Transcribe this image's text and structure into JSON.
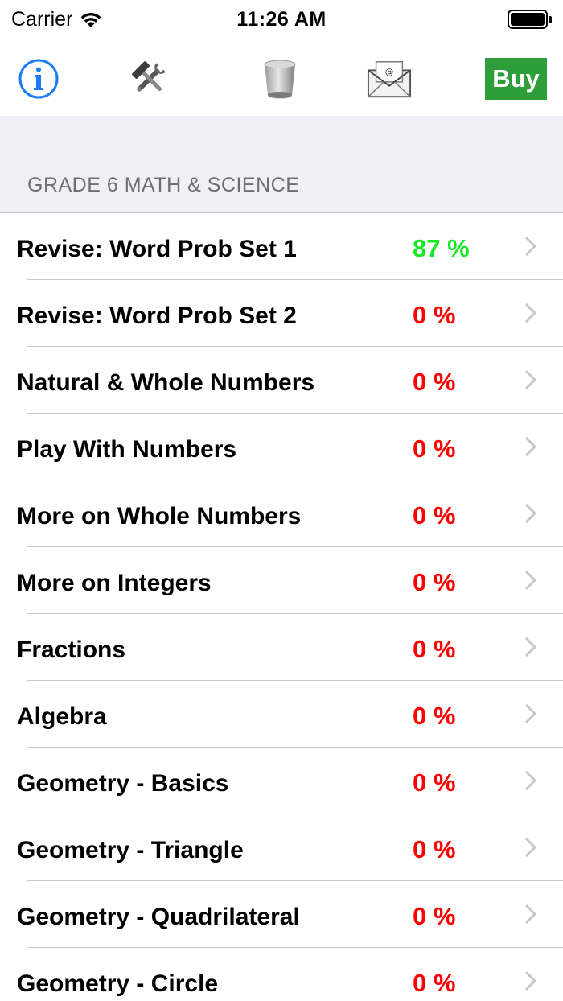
{
  "status_bar": {
    "carrier": "Carrier",
    "time": "11:26 AM"
  },
  "toolbar": {
    "icons": [
      "info-icon",
      "tools-icon",
      "trash-icon",
      "mail-icon"
    ],
    "buy_label": "Buy",
    "buy_color": "#2d9e3a",
    "info_color": "#1a7cf5"
  },
  "section": {
    "title": "GRADE 6 MATH & SCIENCE"
  },
  "colors": {
    "pct_zero": "#ff0000",
    "pct_positive": "#11ea21",
    "chevron": "#c7c7cc"
  },
  "items": [
    {
      "label": "Revise: Word Prob Set 1",
      "percent": "87 %",
      "status": "positive"
    },
    {
      "label": "Revise: Word Prob Set 2",
      "percent": "0 %",
      "status": "zero"
    },
    {
      "label": "Natural & Whole Numbers",
      "percent": "0 %",
      "status": "zero"
    },
    {
      "label": "Play With Numbers",
      "percent": "0 %",
      "status": "zero"
    },
    {
      "label": "More on Whole Numbers",
      "percent": "0 %",
      "status": "zero"
    },
    {
      "label": "More on Integers",
      "percent": "0 %",
      "status": "zero"
    },
    {
      "label": "Fractions",
      "percent": "0 %",
      "status": "zero"
    },
    {
      "label": "Algebra",
      "percent": "0 %",
      "status": "zero"
    },
    {
      "label": "Geometry - Basics",
      "percent": "0 %",
      "status": "zero"
    },
    {
      "label": "Geometry - Triangle",
      "percent": "0 %",
      "status": "zero"
    },
    {
      "label": "Geometry - Quadrilateral",
      "percent": "0 %",
      "status": "zero"
    },
    {
      "label": "Geometry - Circle",
      "percent": "0 %",
      "status": "zero"
    }
  ]
}
